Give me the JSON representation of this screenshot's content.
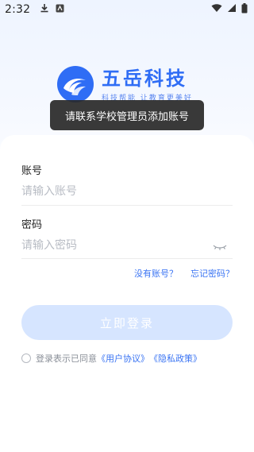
{
  "status_bar": {
    "time": "2:32",
    "left_icons": [
      "download-icon",
      "notification-app-icon"
    ],
    "right_icons": [
      "wifi-icon",
      "signal-icon",
      "battery-icon"
    ]
  },
  "logo": {
    "title": "五岳科技",
    "slogan": "科技帮能 让教育更美好"
  },
  "toast": {
    "message": "请联系学校管理员添加账号"
  },
  "form": {
    "account_label": "账号",
    "account_placeholder": "请输入账号",
    "account_value": "",
    "password_label": "密码",
    "password_placeholder": "请输入密码",
    "password_value": ""
  },
  "links": {
    "no_account": "没有账号？",
    "forgot_password": "忘记密码？"
  },
  "login_button": "立即登录",
  "agreement": {
    "prefix": "登录表示已同意",
    "user_agreement": "《用户协议》",
    "privacy_policy": "《隐私政策》",
    "checked": false
  },
  "colors": {
    "brand": "#2f6df5",
    "link": "#3a74f3",
    "button_disabled": "#d6e5ff"
  }
}
